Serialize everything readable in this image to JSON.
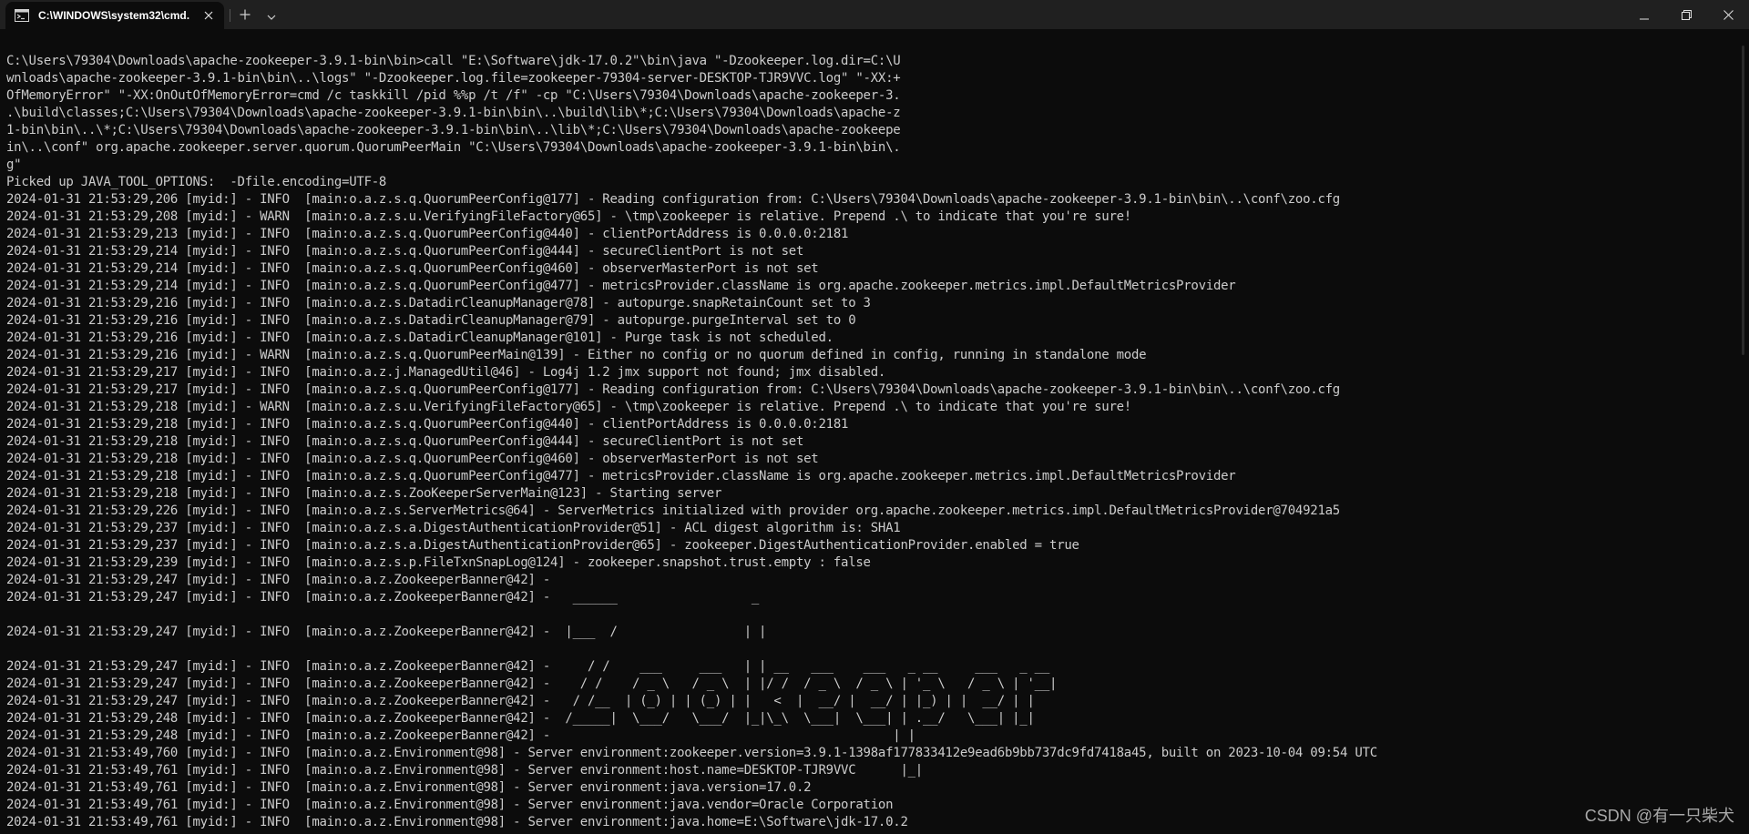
{
  "window": {
    "tab_title": "C:\\WINDOWS\\system32\\cmd.",
    "icons": {
      "tab": "terminal-icon",
      "close_tab": "close-icon",
      "new_tab": "plus-icon",
      "dropdown": "chevron-down-icon",
      "minimize": "minimize-icon",
      "maximize": "restore-icon",
      "close": "close-icon"
    }
  },
  "console": {
    "lines": [
      "C:\\Users\\79304\\Downloads\\apache-zookeeper-3.9.1-bin\\bin>call \"E:\\Software\\jdk-17.0.2\"\\bin\\java \"-Dzookeeper.log.dir=C:\\U",
      "wnloads\\apache-zookeeper-3.9.1-bin\\bin\\..\\logs\" \"-Dzookeeper.log.file=zookeeper-79304-server-DESKTOP-TJR9VVC.log\" \"-XX:+",
      "OfMemoryError\" \"-XX:OnOutOfMemoryError=cmd /c taskkill /pid %%p /t /f\" -cp \"C:\\Users\\79304\\Downloads\\apache-zookeeper-3.",
      ".\\build\\classes;C:\\Users\\79304\\Downloads\\apache-zookeeper-3.9.1-bin\\bin\\..\\build\\lib\\*;C:\\Users\\79304\\Downloads\\apache-z",
      "1-bin\\bin\\..\\*;C:\\Users\\79304\\Downloads\\apache-zookeeper-3.9.1-bin\\bin\\..\\lib\\*;C:\\Users\\79304\\Downloads\\apache-zookeepe",
      "in\\..\\conf\" org.apache.zookeeper.server.quorum.QuorumPeerMain \"C:\\Users\\79304\\Downloads\\apache-zookeeper-3.9.1-bin\\bin\\.",
      "g\"",
      "Picked up JAVA_TOOL_OPTIONS:  -Dfile.encoding=UTF-8",
      "2024-01-31 21:53:29,206 [myid:] - INFO  [main:o.a.z.s.q.QuorumPeerConfig@177] - Reading configuration from: C:\\Users\\79304\\Downloads\\apache-zookeeper-3.9.1-bin\\bin\\..\\conf\\zoo.cfg",
      "2024-01-31 21:53:29,208 [myid:] - WARN  [main:o.a.z.s.u.VerifyingFileFactory@65] - \\tmp\\zookeeper is relative. Prepend .\\ to indicate that you're sure!",
      "2024-01-31 21:53:29,213 [myid:] - INFO  [main:o.a.z.s.q.QuorumPeerConfig@440] - clientPortAddress is 0.0.0.0:2181",
      "2024-01-31 21:53:29,214 [myid:] - INFO  [main:o.a.z.s.q.QuorumPeerConfig@444] - secureClientPort is not set",
      "2024-01-31 21:53:29,214 [myid:] - INFO  [main:o.a.z.s.q.QuorumPeerConfig@460] - observerMasterPort is not set",
      "2024-01-31 21:53:29,214 [myid:] - INFO  [main:o.a.z.s.q.QuorumPeerConfig@477] - metricsProvider.className is org.apache.zookeeper.metrics.impl.DefaultMetricsProvider",
      "2024-01-31 21:53:29,216 [myid:] - INFO  [main:o.a.z.s.DatadirCleanupManager@78] - autopurge.snapRetainCount set to 3",
      "2024-01-31 21:53:29,216 [myid:] - INFO  [main:o.a.z.s.DatadirCleanupManager@79] - autopurge.purgeInterval set to 0",
      "2024-01-31 21:53:29,216 [myid:] - INFO  [main:o.a.z.s.DatadirCleanupManager@101] - Purge task is not scheduled.",
      "2024-01-31 21:53:29,216 [myid:] - WARN  [main:o.a.z.s.q.QuorumPeerMain@139] - Either no config or no quorum defined in config, running in standalone mode",
      "2024-01-31 21:53:29,217 [myid:] - INFO  [main:o.a.z.j.ManagedUtil@46] - Log4j 1.2 jmx support not found; jmx disabled.",
      "2024-01-31 21:53:29,217 [myid:] - INFO  [main:o.a.z.s.q.QuorumPeerConfig@177] - Reading configuration from: C:\\Users\\79304\\Downloads\\apache-zookeeper-3.9.1-bin\\bin\\..\\conf\\zoo.cfg",
      "2024-01-31 21:53:29,218 [myid:] - WARN  [main:o.a.z.s.u.VerifyingFileFactory@65] - \\tmp\\zookeeper is relative. Prepend .\\ to indicate that you're sure!",
      "2024-01-31 21:53:29,218 [myid:] - INFO  [main:o.a.z.s.q.QuorumPeerConfig@440] - clientPortAddress is 0.0.0.0:2181",
      "2024-01-31 21:53:29,218 [myid:] - INFO  [main:o.a.z.s.q.QuorumPeerConfig@444] - secureClientPort is not set",
      "2024-01-31 21:53:29,218 [myid:] - INFO  [main:o.a.z.s.q.QuorumPeerConfig@460] - observerMasterPort is not set",
      "2024-01-31 21:53:29,218 [myid:] - INFO  [main:o.a.z.s.q.QuorumPeerConfig@477] - metricsProvider.className is org.apache.zookeeper.metrics.impl.DefaultMetricsProvider",
      "2024-01-31 21:53:29,218 [myid:] - INFO  [main:o.a.z.s.ZooKeeperServerMain@123] - Starting server",
      "2024-01-31 21:53:29,226 [myid:] - INFO  [main:o.a.z.s.ServerMetrics@64] - ServerMetrics initialized with provider org.apache.zookeeper.metrics.impl.DefaultMetricsProvider@704921a5",
      "2024-01-31 21:53:29,237 [myid:] - INFO  [main:o.a.z.s.a.DigestAuthenticationProvider@51] - ACL digest algorithm is: SHA1",
      "2024-01-31 21:53:29,237 [myid:] - INFO  [main:o.a.z.s.a.DigestAuthenticationProvider@65] - zookeeper.DigestAuthenticationProvider.enabled = true",
      "2024-01-31 21:53:29,239 [myid:] - INFO  [main:o.a.z.s.p.FileTxnSnapLog@124] - zookeeper.snapshot.trust.empty : false",
      "2024-01-31 21:53:29,247 [myid:] - INFO  [main:o.a.z.ZookeeperBanner@42] -",
      "2024-01-31 21:53:29,247 [myid:] - INFO  [main:o.a.z.ZookeeperBanner@42] -   ______                  _",
      "",
      "2024-01-31 21:53:29,247 [myid:] - INFO  [main:o.a.z.ZookeeperBanner@42] -  |___  /                 | |",
      "",
      "2024-01-31 21:53:29,247 [myid:] - INFO  [main:o.a.z.ZookeeperBanner@42] -     / /    ___     ___   | | __   ___    ___   _ __     ___   _ __",
      "2024-01-31 21:53:29,247 [myid:] - INFO  [main:o.a.z.ZookeeperBanner@42] -    / /    / _ \\   / _ \\  | |/ /  / _ \\  / _ \\ | '_ \\   / _ \\ | '__|",
      "2024-01-31 21:53:29,247 [myid:] - INFO  [main:o.a.z.ZookeeperBanner@42] -   / /__  | (_) | | (_) | |   <  |  __/ |  __/ | |_) | |  __/ | |",
      "2024-01-31 21:53:29,248 [myid:] - INFO  [main:o.a.z.ZookeeperBanner@42] -  /_____|  \\___/   \\___/  |_|\\_\\  \\___|  \\___| | .__/   \\___| |_|",
      "2024-01-31 21:53:29,248 [myid:] - INFO  [main:o.a.z.ZookeeperBanner@42] -                                              | |",
      "2024-01-31 21:53:49,760 [myid:] - INFO  [main:o.a.z.Environment@98] - Server environment:zookeeper.version=3.9.1-1398af177833412e9ead6b9bb737dc9fd7418a45, built on 2023-10-04 09:54 UTC",
      "2024-01-31 21:53:49,761 [myid:] - INFO  [main:o.a.z.Environment@98] - Server environment:host.name=DESKTOP-TJR9VVC      |_|",
      "2024-01-31 21:53:49,761 [myid:] - INFO  [main:o.a.z.Environment@98] - Server environment:java.version=17.0.2",
      "2024-01-31 21:53:49,761 [myid:] - INFO  [main:o.a.z.Environment@98] - Server environment:java.vendor=Oracle Corporation",
      "2024-01-31 21:53:49,761 [myid:] - INFO  [main:o.a.z.Environment@98] - Server environment:java.home=E:\\Software\\jdk-17.0.2"
    ]
  },
  "watermark": "CSDN @有一只柴犬"
}
